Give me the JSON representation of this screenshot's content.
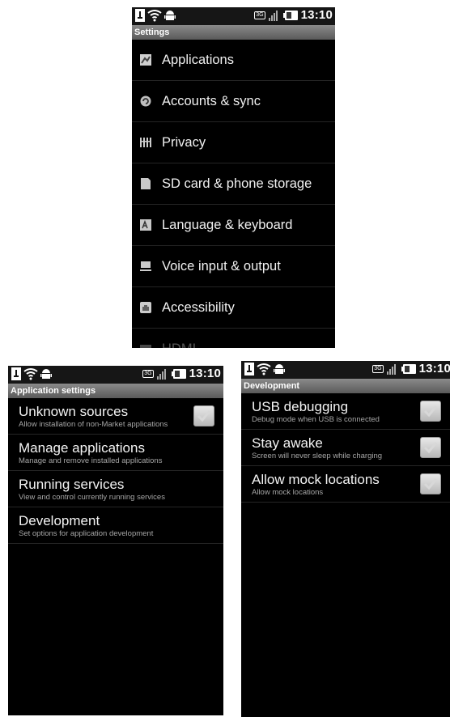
{
  "screens": [
    {
      "status": {
        "time": "13:10",
        "network": "3G"
      },
      "title": "Settings",
      "items": [
        {
          "label": "Applications",
          "icon": "applications-icon"
        },
        {
          "label": "Accounts & sync",
          "icon": "accounts-sync-icon"
        },
        {
          "label": "Privacy",
          "icon": "privacy-icon"
        },
        {
          "label": "SD card & phone storage",
          "icon": "sd-card-icon"
        },
        {
          "label": "Language & keyboard",
          "icon": "language-keyboard-icon"
        },
        {
          "label": "Voice input & output",
          "icon": "voice-icon"
        },
        {
          "label": "Accessibility",
          "icon": "accessibility-icon"
        },
        {
          "label": "HDMI",
          "icon": "hdmi-icon"
        }
      ]
    },
    {
      "status": {
        "time": "13:10",
        "network": "3G"
      },
      "title": "Application settings",
      "items": [
        {
          "title": "Unknown sources",
          "summary": "Allow installation of non-Market applications",
          "checkbox": true
        },
        {
          "title": "Manage applications",
          "summary": "Manage and remove installed applications",
          "checkbox": false
        },
        {
          "title": "Running services",
          "summary": "View and control currently running services",
          "checkbox": false
        },
        {
          "title": "Development",
          "summary": "Set options for application development",
          "checkbox": false
        }
      ]
    },
    {
      "status": {
        "time": "13:10",
        "network": "3G"
      },
      "title": "Development",
      "items": [
        {
          "title": "USB debugging",
          "summary": "Debug mode when USB is connected",
          "checkbox": true
        },
        {
          "title": "Stay awake",
          "summary": "Screen will never sleep while charging",
          "checkbox": true
        },
        {
          "title": "Allow mock locations",
          "summary": "Allow mock locations",
          "checkbox": true
        }
      ]
    }
  ],
  "colors": {
    "background": "#000000",
    "title_bar": "#6e6e6e",
    "text": "#f0f0f0",
    "summary": "#a6a6a6"
  }
}
